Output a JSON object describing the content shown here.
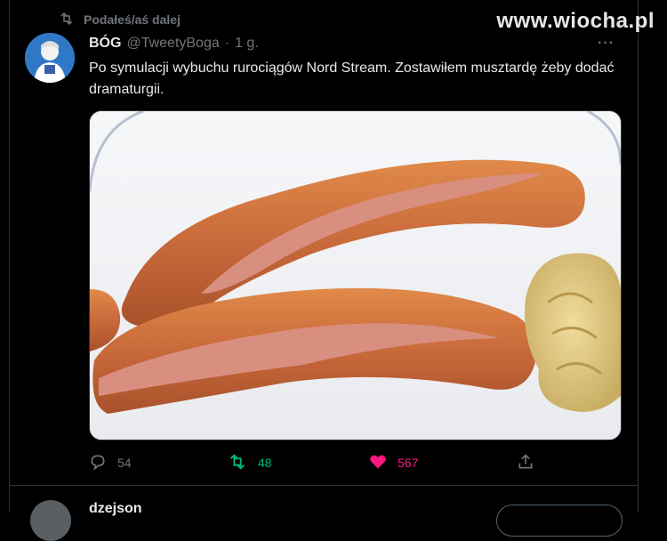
{
  "retweet": {
    "label": "Podałeś/aś dalej",
    "icon": "retweet-icon"
  },
  "watermark": "www.wiocha.pl",
  "tweet": {
    "name": "BÓG",
    "handle": "@TweetyBoga",
    "dot": "·",
    "time": "1 g.",
    "more": "···",
    "text": "Po symulacji wybuchu rurociągów Nord Stream. Zostawiłem musztardę żeby dodać dramaturgii."
  },
  "actions": {
    "reply_count": "54",
    "retweet_count": "48",
    "like_count": "567"
  },
  "colors": {
    "background": "#000000",
    "muted": "#71767b",
    "retweet": "#00ba7c",
    "like": "#f91880"
  },
  "next_tweet": {
    "name": "dzejson"
  }
}
